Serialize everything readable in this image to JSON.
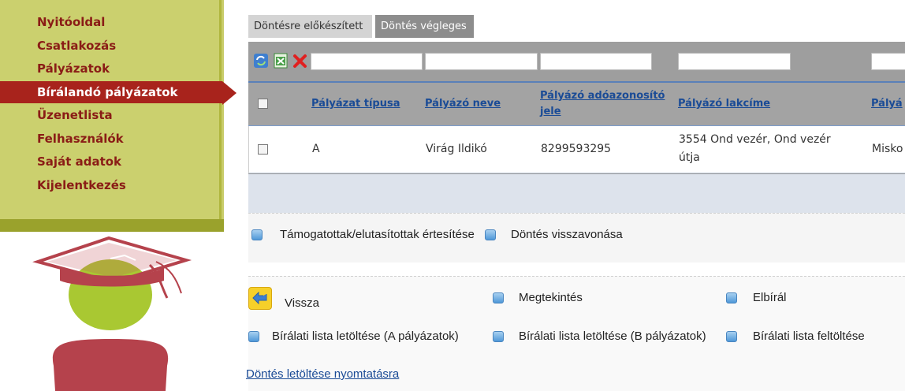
{
  "sidebar": {
    "items": [
      {
        "label": "Nyitóoldal"
      },
      {
        "label": "Csatlakozás"
      },
      {
        "label": "Pályázatok"
      },
      {
        "label": "Bírálandó pályázatok"
      },
      {
        "label": "Üzenetlista"
      },
      {
        "label": "Felhasználók"
      },
      {
        "label": "Saját adatok"
      },
      {
        "label": "Kijelentkezés"
      }
    ],
    "active_index": 3
  },
  "tabs": [
    {
      "label": "Döntésre előkészített"
    },
    {
      "label": "Döntés végleges"
    }
  ],
  "grid": {
    "toolbar_icons": [
      "refresh-icon",
      "excel-export-icon",
      "delete-icon"
    ],
    "filters": [
      "",
      "",
      "",
      "",
      ""
    ],
    "columns": [
      "Pályázat típusa",
      "Pályázó neve",
      "Pályázó adóazonosító jele",
      "Pályázó lakcíme",
      "Pályá"
    ],
    "rows": [
      [
        "A",
        "Virág Ildikó",
        "8299593295",
        "3554 Ond vezér, Ond vezér útja",
        "Misko"
      ]
    ]
  },
  "actions_primary": [
    {
      "label": "Támogatottak/elutasítottak értesítése"
    },
    {
      "label": "Döntés visszavonása"
    }
  ],
  "actions_secondary": [
    {
      "label": "Vissza",
      "icon": "back-arrow-icon"
    },
    {
      "label": "Megtekintés"
    },
    {
      "label": "Elbírál"
    },
    {
      "label": "Bírálati lista letöltése (A pályázatok)"
    },
    {
      "label": "Bírálati lista letöltése (B pályázatok)"
    },
    {
      "label": "Bírálati lista feltöltése"
    }
  ],
  "print_link": "Döntés letöltése nyomtatásra",
  "colors": {
    "sidebar_bg": "#cbd06e",
    "menu_text": "#8a1c16",
    "menu_active_bg": "#a8231c",
    "link": "#1a4b96"
  }
}
